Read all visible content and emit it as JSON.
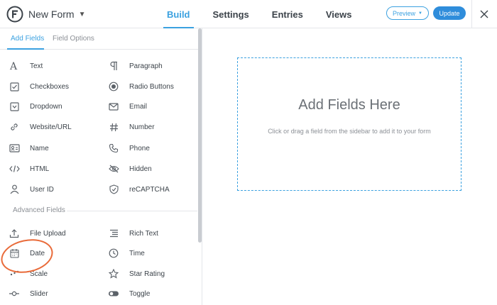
{
  "header": {
    "form_title": "New Form",
    "nav": [
      {
        "label": "Build",
        "active": true
      },
      {
        "label": "Settings",
        "active": false
      },
      {
        "label": "Entries",
        "active": false
      },
      {
        "label": "Views",
        "active": false
      }
    ],
    "preview_label": "Preview",
    "update_label": "Update",
    "accent_color": "#3ba1e0"
  },
  "sidebar": {
    "tabs": [
      {
        "label": "Add Fields",
        "active": true
      },
      {
        "label": "Field Options",
        "active": false
      }
    ],
    "basic_fields": [
      {
        "label": "Text",
        "icon": "text-icon"
      },
      {
        "label": "Paragraph",
        "icon": "paragraph-icon"
      },
      {
        "label": "Checkboxes",
        "icon": "checkbox-icon"
      },
      {
        "label": "Radio Buttons",
        "icon": "radio-icon"
      },
      {
        "label": "Dropdown",
        "icon": "dropdown-icon"
      },
      {
        "label": "Email",
        "icon": "email-icon"
      },
      {
        "label": "Website/URL",
        "icon": "link-icon"
      },
      {
        "label": "Number",
        "icon": "hash-icon"
      },
      {
        "label": "Name",
        "icon": "name-card-icon"
      },
      {
        "label": "Phone",
        "icon": "phone-icon"
      },
      {
        "label": "HTML",
        "icon": "code-icon"
      },
      {
        "label": "Hidden",
        "icon": "eye-slash-icon"
      },
      {
        "label": "User ID",
        "icon": "user-icon"
      },
      {
        "label": "reCAPTCHA",
        "icon": "shield-icon"
      }
    ],
    "advanced_label": "Advanced Fields",
    "advanced_fields": [
      {
        "label": "File Upload",
        "icon": "upload-icon"
      },
      {
        "label": "Rich Text",
        "icon": "rich-text-icon"
      },
      {
        "label": "Date",
        "icon": "calendar-icon"
      },
      {
        "label": "Time",
        "icon": "clock-icon"
      },
      {
        "label": "Scale",
        "icon": "scale-icon"
      },
      {
        "label": "Star Rating",
        "icon": "star-icon"
      },
      {
        "label": "Slider",
        "icon": "slider-icon"
      },
      {
        "label": "Toggle",
        "icon": "toggle-icon"
      }
    ]
  },
  "canvas": {
    "title": "Add Fields Here",
    "subtitle": "Click or drag a field from the sidebar to add it to your form"
  },
  "annotation_color": "#e96b3a"
}
